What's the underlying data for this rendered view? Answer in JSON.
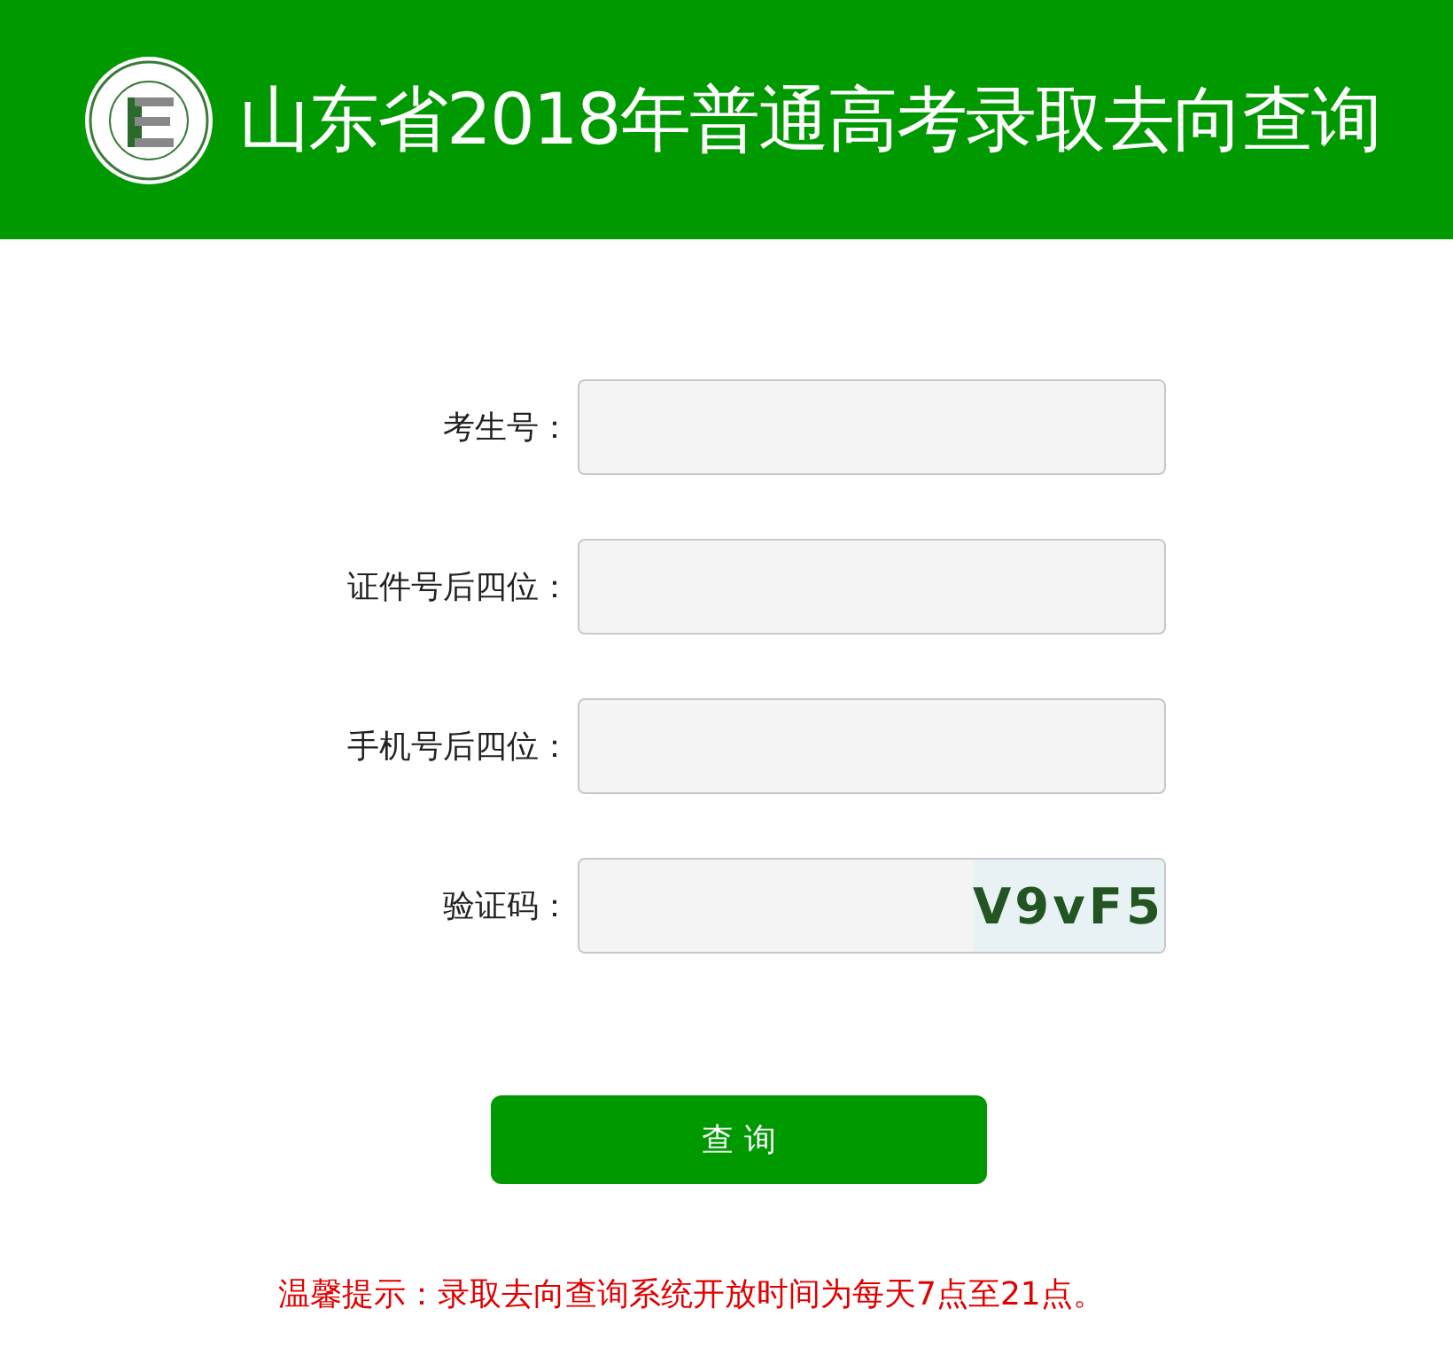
{
  "header": {
    "title": "山东省2018年普通高考录取去向查询"
  },
  "form": {
    "fields": [
      {
        "label": "考生号：",
        "kind": "text"
      },
      {
        "label": "证件号后四位：",
        "kind": "text"
      },
      {
        "label": "手机号后四位：",
        "kind": "text"
      },
      {
        "label": "验证码：",
        "kind": "captcha",
        "captcha": "V9vF5"
      }
    ],
    "submit": "查 询"
  },
  "notice": "温馨提示：录取去向查询系统开放时间为每天7点至21点。"
}
